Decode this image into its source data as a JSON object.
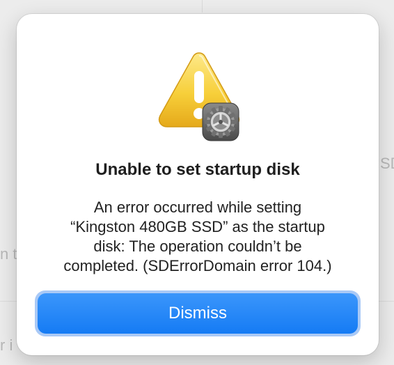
{
  "background": {
    "text_left_1": "n th",
    "text_left_2": "r i",
    "text_right_1": "SD"
  },
  "alert": {
    "icon": "warning-triangle-with-gear-badge-icon",
    "title": "Unable to set startup disk",
    "message_lines": [
      "An error occurred while setting",
      "“Kingston 480GB SSD” as the startup",
      "disk: The operation couldn’t be",
      "completed. (SDErrorDomain error 104.)"
    ],
    "dismiss_label": "Dismiss"
  },
  "colors": {
    "accent_button": "#1e84f8",
    "focus_ring": "#a9c9f6",
    "warning_yellow": "#f6c323",
    "dialog_background": "#ffffff"
  }
}
